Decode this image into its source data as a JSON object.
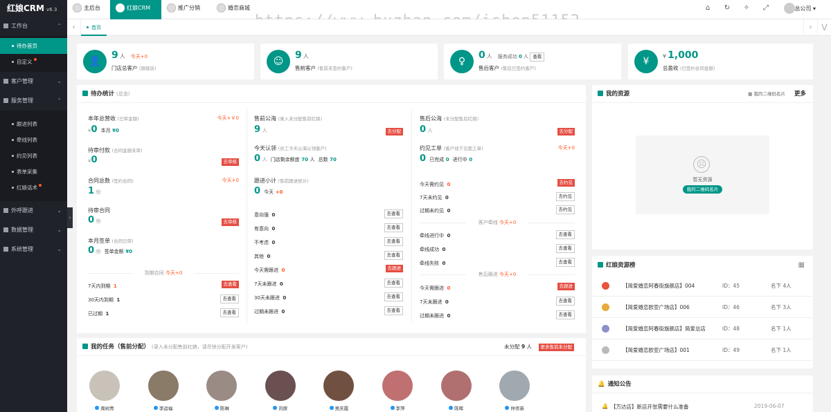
{
  "app": {
    "logo": "红娘CRM",
    "version": "v6.3"
  },
  "watermark": "https://www.huzhan.com/ishop51152",
  "sidebar": {
    "groups": [
      {
        "label": "工作台",
        "items": [
          {
            "label": "待办首页",
            "active": true
          },
          {
            "label": "自定义",
            "badge": true
          }
        ]
      },
      {
        "label": "客户管理",
        "items": []
      },
      {
        "label": "服务管理",
        "items": [
          {
            "label": "跟进列表"
          },
          {
            "label": "牵线列表"
          },
          {
            "label": "约见列表"
          },
          {
            "label": "表单采集"
          },
          {
            "label": "红娘话术",
            "badge": true
          }
        ]
      },
      {
        "label": "外呼跟进",
        "items": []
      },
      {
        "label": "数据管理",
        "items": []
      },
      {
        "label": "系统管理",
        "items": []
      }
    ]
  },
  "topbar": {
    "tabs": [
      {
        "label": "主后台"
      },
      {
        "label": "红娘CRM",
        "active": true
      },
      {
        "label": "推广分销"
      },
      {
        "label": "婚恋商城"
      }
    ],
    "user": "总公司"
  },
  "tabbar": {
    "home": "首页"
  },
  "stats": [
    {
      "icon": "user-icon",
      "num": "9",
      "unit": "人",
      "extra": "今天+0",
      "label": "门店总客户",
      "sub": "(旗舰店)"
    },
    {
      "icon": "headset-icon",
      "num": "9",
      "unit": "人",
      "label": "售前客户",
      "sub": "(售前未签约客户)"
    },
    {
      "icon": "woman-icon",
      "num": "0",
      "unit": "人",
      "extra2": "服务成功",
      "extra2_num": "0",
      "extra2_unit": "人",
      "extra2_btn": "查看",
      "label": "售后客户",
      "sub": "(售后已签约客户)"
    },
    {
      "icon": "yen-icon",
      "prefix": "¥",
      "num": "1,000",
      "label": "总盈收",
      "sub": "(已签约合同金额)"
    }
  ],
  "todo": {
    "title": "待办统计",
    "title_sub": "(总览)",
    "col1": {
      "annual": {
        "title": "本年总营收",
        "sub": "(已审金额)",
        "today": "今天+￥0",
        "yen": "¥",
        "num": "0",
        "month_label": "本月",
        "month_val": "¥0"
      },
      "pending_pay": {
        "title": "待审付款",
        "sub": "(合同金额未审)",
        "yen": "¥",
        "num": "0",
        "btn": "去审核"
      },
      "contracts": {
        "title": "合同总数",
        "sub": "(签约合同)",
        "today": "今天+0",
        "num": "1",
        "unit": "份"
      },
      "pending_contract": {
        "title": "待审合同",
        "num": "0",
        "unit": "份",
        "btn": "去审核"
      },
      "month_sign": {
        "title": "本月签单",
        "sub": "(合同已审)",
        "num": "0",
        "unit": "份",
        "amount_label": "签单金额",
        "amount_val": "¥0"
      },
      "expire_divider": {
        "label": "到期合同",
        "today": "今天+0"
      },
      "expire_rows": [
        {
          "label": "7天内到期",
          "val": "1",
          "btn": "去查看",
          "red": true
        },
        {
          "label": "30天内到期",
          "val": "1",
          "btn": "去查看"
        },
        {
          "label": "已过期",
          "val": "1",
          "btn": "去查看"
        }
      ]
    },
    "col2": {
      "presale_sea": {
        "title": "售前公海",
        "sub": "(录入未分配售前红娘)",
        "num": "9",
        "unit": "人",
        "btn": "去分配"
      },
      "today_claim": {
        "title": "今天认领",
        "sub": "(员工今天公海认领客户)",
        "num": "0",
        "unit": "人",
        "quota_label": "门店剩余额度",
        "quota_val": "70",
        "quota_unit": "人",
        "total_label": "总数",
        "total_val": "70"
      },
      "followup": {
        "title": "跟进小计",
        "sub": "(售前跟进统计)",
        "num": "0",
        "today_label": "今天",
        "today_val": "+0"
      },
      "rows": [
        {
          "label": "意向强",
          "val": "0",
          "btn": "去查看"
        },
        {
          "label": "有意向",
          "val": "0",
          "btn": "去查看"
        },
        {
          "label": "不考虑",
          "val": "0",
          "btn": "去查看"
        },
        {
          "label": "其他",
          "val": "0",
          "btn": "去查看"
        },
        {
          "label": "今天需跟进",
          "val": "0",
          "btn": "去跟进",
          "red": true
        },
        {
          "label": "7天未跟进",
          "val": "0",
          "btn": "去查看"
        },
        {
          "label": "30天未跟进",
          "val": "0",
          "btn": "去查看"
        },
        {
          "label": "过期未跟进",
          "val": "0",
          "btn": "去查看"
        }
      ]
    },
    "col3": {
      "aftersale_sea": {
        "title": "售后公海",
        "sub": "(未分配售后红娘)",
        "num": "0",
        "unit": "人",
        "btn": "去分配"
      },
      "meeting": {
        "title": "约见工单",
        "sub": "(客户线下见面工单)",
        "today": "今天+0",
        "num": "0",
        "done_label": "已完成",
        "done_val": "0",
        "doing_label": "进行中",
        "doing_val": "0"
      },
      "meet_rows": [
        {
          "label": "今天需约见",
          "val": "0",
          "btn": "去约见",
          "red": true
        },
        {
          "label": "7天未约见",
          "val": "0",
          "btn": "去约见"
        },
        {
          "label": "过期未约见",
          "val": "0",
          "btn": "去约见"
        }
      ],
      "match_divider": {
        "label": "客户牵线",
        "today": "今天+0"
      },
      "match_rows": [
        {
          "label": "牵线进行中",
          "val": "0",
          "btn": "去查看"
        },
        {
          "label": "牵线成功",
          "val": "0",
          "btn": "去查看"
        },
        {
          "label": "牵线失败",
          "val": "0",
          "btn": "去查看"
        }
      ],
      "after_divider": {
        "label": "售后跟进",
        "today": "今天+0"
      },
      "after_rows": [
        {
          "label": "今天需跟进",
          "val": "0",
          "btn": "去跟进",
          "red": true
        },
        {
          "label": "7天未跟进",
          "val": "0",
          "btn": "去查看"
        },
        {
          "label": "过期未跟进",
          "val": "0",
          "btn": "去查看"
        }
      ]
    }
  },
  "resources": {
    "title": "我的资源",
    "qr_link": "我的二维码名片",
    "more": "更多",
    "empty": "暂无资源",
    "empty_btn": "我的二维码名片"
  },
  "ranking": {
    "title": "红娘资源榜",
    "rows": [
      {
        "name": "【简爱婚恋阿春街旗舰店】004",
        "id": "ID：45",
        "count": "名下 4人",
        "medal": "#e8533b"
      },
      {
        "name": "【简爱婚恋欧亚广场店】006",
        "id": "ID：46",
        "count": "名下 3人",
        "medal": "#e9a93b"
      },
      {
        "name": "【简爱婚恋阿春街旗舰店】简爱总店",
        "id": "ID：48",
        "count": "名下 1人",
        "medal": "#8b91c8"
      },
      {
        "name": "【简爱婚恋欧亚广场店】001",
        "id": "ID：49",
        "count": "名下 1人",
        "medal": "#bbbbbb"
      }
    ]
  },
  "notice": {
    "title": "通知公告",
    "rows": [
      {
        "text": "【万达店】新店开张需要什么准备",
        "date": "2019-06-07"
      }
    ]
  },
  "tasks": {
    "title": "我的任务（售前分配）",
    "sub": "(录入未分配售前红娘，请尽快分配开发客户)",
    "unassigned_label": "未分配",
    "unassigned_val": "9",
    "unassigned_unit": "人",
    "btn": "更多售前未分配",
    "people": [
      "周树青",
      "李运福",
      "陈琳",
      "刘原",
      "吴庆霞",
      "李萍",
      "陈晖",
      "仲崇新"
    ]
  }
}
